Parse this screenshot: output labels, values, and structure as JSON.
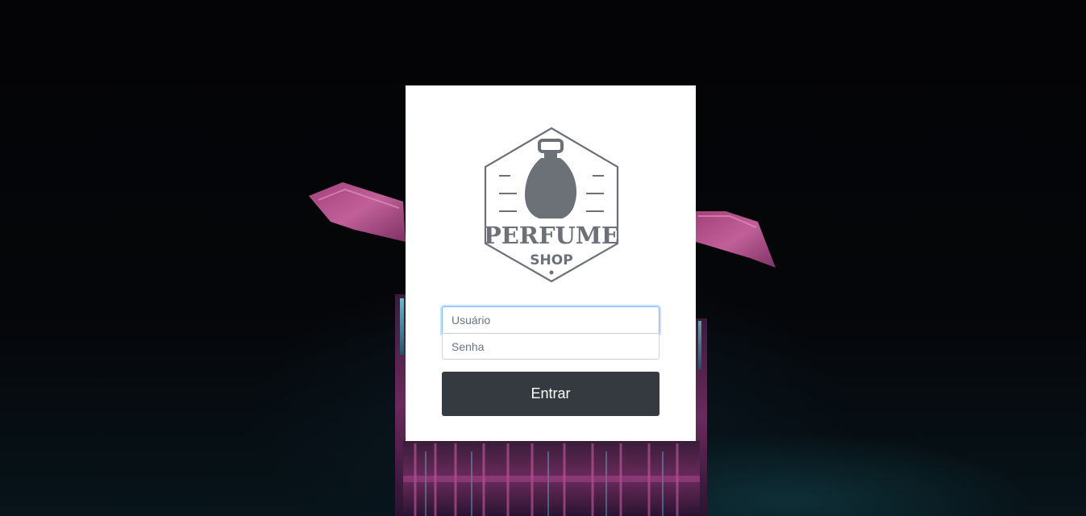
{
  "brand": {
    "line1": "PERFUME",
    "line2": "SHOP",
    "logo_color": "#6c7178"
  },
  "login": {
    "username_placeholder": "Usuário",
    "password_placeholder": "Senha",
    "submit_label": "Entrar"
  },
  "colors": {
    "background": "#050609",
    "card": "#ffffff",
    "button": "#343a40",
    "focus_border": "#80bdff",
    "accent_pink": "#c24a8e",
    "accent_teal": "#5fb6c9"
  }
}
